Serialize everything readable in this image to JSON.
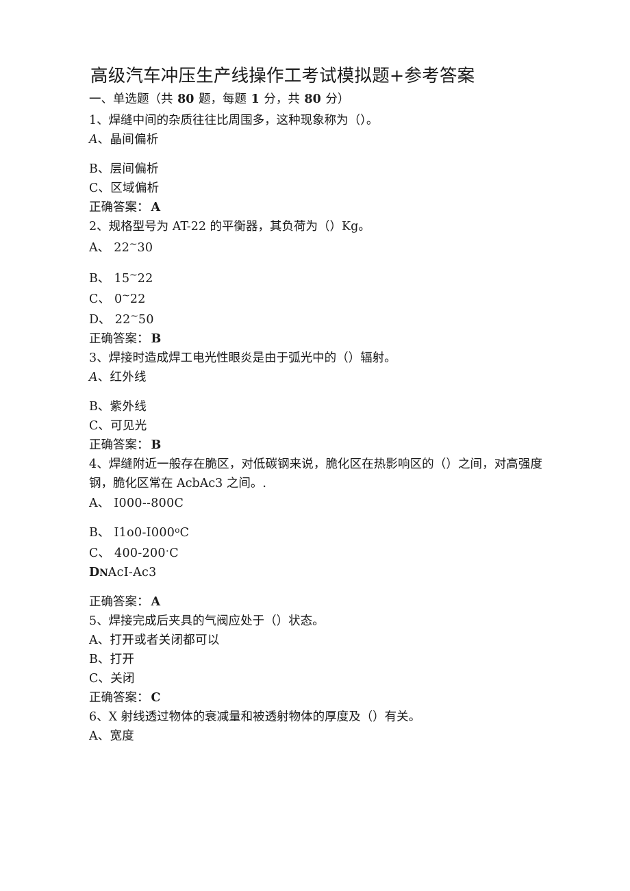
{
  "document": {
    "title": "高级汽车冲压生产线操作工考试模拟题+参考答案",
    "section_heading": {
      "prefix": "一、单选题（共 ",
      "count": "80",
      "mid1": " 题，每题 ",
      "points_each": "1",
      "mid2": " 分，共 ",
      "total_points": "80",
      "suffix": " 分）"
    },
    "answer_label": "正确答案：",
    "questions": [
      {
        "number": "1",
        "stem": "1、焊缝中间的杂质往往比周围多，这种现象称为（）。",
        "options": [
          {
            "label": "A",
            "label_style": "italic",
            "text": "、晶间偏析",
            "gap_below": true
          },
          {
            "label": "B",
            "label_style": "normal",
            "text": "、层间偏析",
            "gap_below": false
          },
          {
            "label": "C",
            "label_style": "normal",
            "text": "、区域偏析",
            "gap_below": false
          }
        ],
        "answer": "A"
      },
      {
        "number": "2",
        "stem": "2、规格型号为 AT-22 的平衡器，其负荷为（）Kg。",
        "options": [
          {
            "label": "A",
            "label_style": "normal",
            "text": "、 22~30",
            "gap_below": true
          },
          {
            "label": "B",
            "label_style": "normal",
            "text": "、 15~22",
            "gap_below": false
          },
          {
            "label": "C",
            "label_style": "normal",
            "text": "、 0~22",
            "gap_below": false
          },
          {
            "label": "D",
            "label_style": "normal",
            "text": "、 22~50",
            "gap_below": false
          }
        ],
        "answer": "B"
      },
      {
        "number": "3",
        "stem": "3、焊接时造成焊工电光性眼炎是由于弧光中的（）辐射。",
        "options": [
          {
            "label": "A",
            "label_style": "italic",
            "text": "、红外线",
            "gap_below": true
          },
          {
            "label": "B",
            "label_style": "normal",
            "text": "、紫外线",
            "gap_below": false
          },
          {
            "label": "C",
            "label_style": "normal",
            "text": "、可见光",
            "gap_below": false
          }
        ],
        "answer": "B"
      },
      {
        "number": "4",
        "stem": "4、焊缝附近一般存在脆区，对低碳钢来说，脆化区在热影响区的（）之间，对高强度钢，脆化区常在 AcbAc3 之间。.",
        "options": [
          {
            "label": "A",
            "label_style": "normal",
            "text": "、 I000--800C",
            "gap_below": true
          },
          {
            "label": "B",
            "label_style": "normal",
            "text": "、 I1o0-I000ºC",
            "gap_below": false
          },
          {
            "label": "C",
            "label_style": "normal",
            "text": "、 400-200·C",
            "gap_below": false
          },
          {
            "label": "D",
            "label_style": "d-bold-smallcap",
            "text": "AcI-Ac3",
            "gap_below": true
          }
        ],
        "answer": "A"
      },
      {
        "number": "5",
        "stem": "5、焊接完成后夹具的气阀应处于（）状态。",
        "options": [
          {
            "label": "A",
            "label_style": "normal",
            "text": "、打开或者关闭都可以",
            "gap_below": false
          },
          {
            "label": "B",
            "label_style": "normal",
            "text": "、打开",
            "gap_below": false
          },
          {
            "label": "C",
            "label_style": "normal",
            "text": "、关闭",
            "gap_below": false
          }
        ],
        "answer": "C"
      },
      {
        "number": "6",
        "stem": "6、X 射线透过物体的衰减量和被透射物体的厚度及（）有关。",
        "options": [
          {
            "label": "A",
            "label_style": "normal",
            "text": "、宽度",
            "gap_below": false
          }
        ],
        "answer": null
      }
    ]
  }
}
